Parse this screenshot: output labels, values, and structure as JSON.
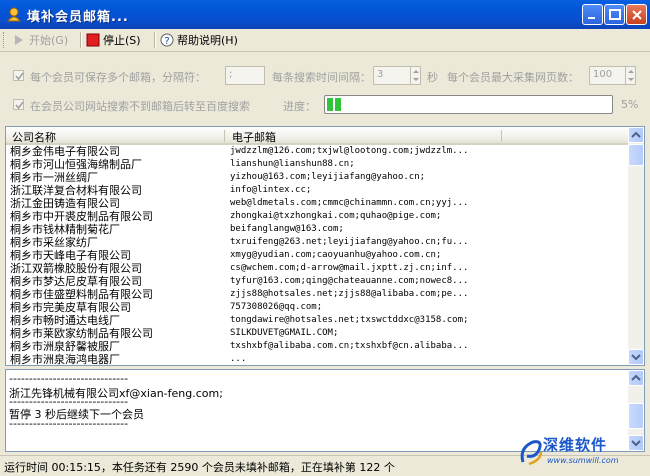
{
  "window": {
    "title": "填补会员邮箱..."
  },
  "toolbar": {
    "start_label": "开始(G)",
    "stop_label": "停止(S)",
    "help_label": "帮助说明(H)"
  },
  "options": {
    "multi_email_label": "每个会员可保存多个邮箱，分隔符：",
    "separator_value": ";",
    "search_interval_label": "每条搜索时间间隔：",
    "interval_value": "3",
    "seconds_unit": "秒",
    "max_pages_label": "每个会员最大采集网页数：",
    "max_pages_value": "100",
    "baidu_fallback_label": "在会员公司网站搜索不到邮箱后转至百度搜索",
    "progress_label": "进度：",
    "progress_percent_text": "5%",
    "progress_value": 5
  },
  "list": {
    "columns": [
      "公司名称",
      "电子邮箱"
    ],
    "rows": [
      [
        "桐乡金伟电子有限公司",
        "jwdzzlm@126.com;txjwl@lootong.com;jwdzzlm..."
      ],
      [
        "桐乡市河山恒强海绵制品厂",
        "lianshun@lianshun88.cn;"
      ],
      [
        "桐乡市一洲丝绸厂",
        "yizhou@163.com;leyijiafang@yahoo.cn;"
      ],
      [
        "浙江联洋复合材料有限公司",
        "info@lintex.cc;"
      ],
      [
        "浙江金田铸造有限公司",
        "web@ldmetals.com;cmmc@chinammn.com.cn;yyj..."
      ],
      [
        "桐乡市中开裘皮制品有限公司",
        "zhongkai@txzhongkai.com;quhao@pige.com;"
      ],
      [
        "桐乡市钱林精制菊花厂",
        "beifanglangw@163.com;"
      ],
      [
        "桐乡市采丝家纺厂",
        "txruifeng@263.net;leyijiafang@yahoo.cn;fu..."
      ],
      [
        "桐乡市天峰电子有限公司",
        "xmyg@yudian.com;caoyuanhu@yahoo.com.cn;"
      ],
      [
        "浙江双箭橡胶股份有限公司",
        "cs@wchem.com;d-arrow@mail.jxptt.zj.cn;inf..."
      ],
      [
        "桐乡市梦达尼皮草有限公司",
        "tyfur@163.com;qing@chateauanne.com;nowec8..."
      ],
      [
        "桐乡市佳盛塑料制品有限公司",
        "zjjs88@hotsales.net;zjjs88@alibaba.com;pe..."
      ],
      [
        "桐乡市完美皮草有限公司",
        "757308026@qq.com;"
      ],
      [
        "桐乡市畅时通达电线厂",
        "tongdawire@hotsales.net;txswctddxc@3158.com;"
      ],
      [
        "桐乡市莱欧家纺制品有限公司",
        "SILKDUVET@GMAIL.COM;"
      ],
      [
        "桐乡市洲泉舒馨被服厂",
        "txshxbf@alibaba.com.cn;txshxbf@cn.alibaba..."
      ],
      [
        "桐乡市洲泉海鸿电器厂",
        "..."
      ]
    ]
  },
  "log": {
    "lines": [
      "------------------------------",
      "浙江先锋机械有限公司xf@xian-feng.com;",
      "------------------------------",
      "暂停  3 秒后继续下一个会员",
      "------------------------------"
    ]
  },
  "status": {
    "text": "运行时间  00:15:15，本任务还有  2590 个会员未填补邮箱，正在填补第  122 个"
  },
  "brand": {
    "name": "深维软件",
    "url": "www.sumwill.com"
  }
}
